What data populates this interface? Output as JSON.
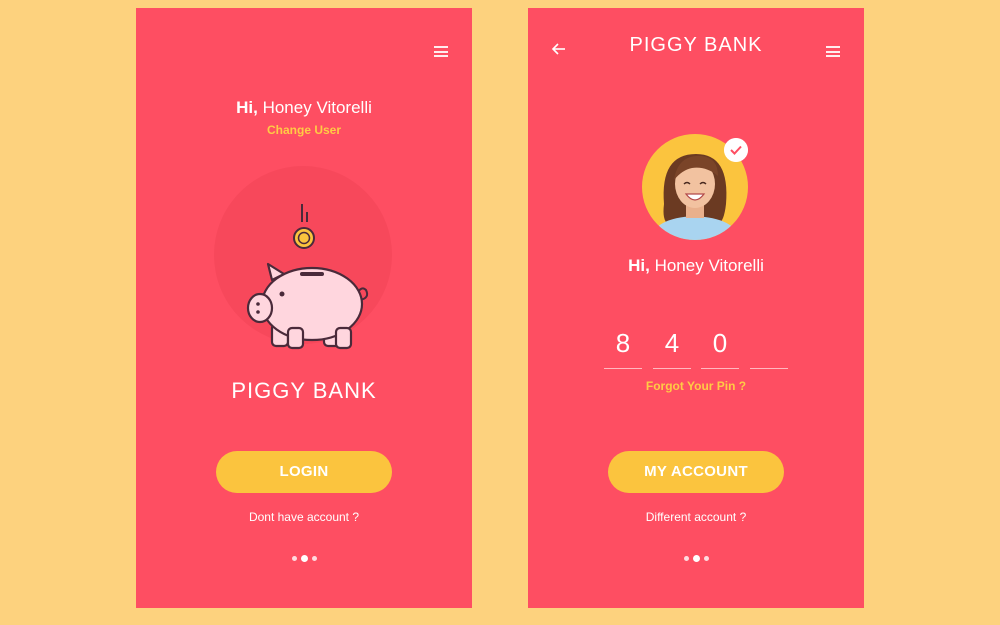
{
  "colors": {
    "page_bg": "#FDD27E",
    "screen_bg": "#FE4E62",
    "accent_yellow": "#FBC43E",
    "link_yellow": "#FFCB45"
  },
  "login_screen": {
    "greeting_prefix": "Hi,",
    "user_name": "Honey Vitorelli",
    "change_user": "Change User",
    "app_title": "PIGGY BANK",
    "login_label": "LOGIN",
    "no_account": "Dont have account ?",
    "menu_icon": "hamburger-menu-icon",
    "illustration": "piggy-bank-with-coin",
    "pager": {
      "pages": 3,
      "active": 2
    }
  },
  "pin_screen": {
    "app_title": "PIGGY BANK",
    "back_icon": "back-arrow-icon",
    "menu_icon": "hamburger-menu-icon",
    "verified_icon": "checkmark-icon",
    "greeting_prefix": "Hi,",
    "user_name": "Honey Vitorelli",
    "pin_digits": [
      "8",
      "4",
      "0",
      ""
    ],
    "forgot_pin": "Forgot Your Pin ?",
    "account_label": "MY ACCOUNT",
    "different_account": "Different account ?",
    "pager": {
      "pages": 3,
      "active": 2
    }
  }
}
